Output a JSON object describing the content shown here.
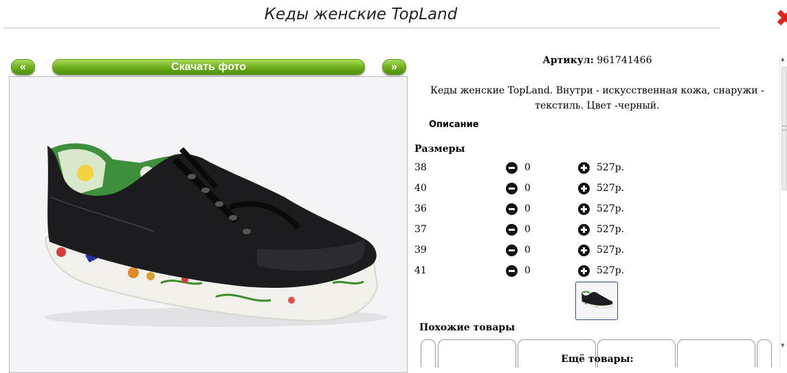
{
  "header": {
    "title": "Кеды женские TopLand"
  },
  "gallery": {
    "prev_label": "«",
    "download_label": "Скачать фото",
    "next_label": "»"
  },
  "product": {
    "article_label": "Артикул:",
    "article_value": "961741466",
    "description": "Кеды женские TopLand. Внутри - искусственная кожа, снаружи - текстиль. Цвет -черный.",
    "description_link": "Описание"
  },
  "sizes": {
    "title": "Размеры",
    "rows": [
      {
        "size": "38",
        "qty": "0",
        "price": "527р."
      },
      {
        "size": "40",
        "qty": "0",
        "price": "527р."
      },
      {
        "size": "36",
        "qty": "0",
        "price": "527р."
      },
      {
        "size": "37",
        "qty": "0",
        "price": "527р."
      },
      {
        "size": "39",
        "qty": "0",
        "price": "527р."
      },
      {
        "size": "41",
        "qty": "0",
        "price": "527р."
      }
    ]
  },
  "similar": {
    "title": "Похожие товары"
  },
  "more": {
    "title": "Ещё товары:"
  },
  "colors": {
    "button_green": "#6bad1a",
    "close_red": "#e0221a"
  }
}
